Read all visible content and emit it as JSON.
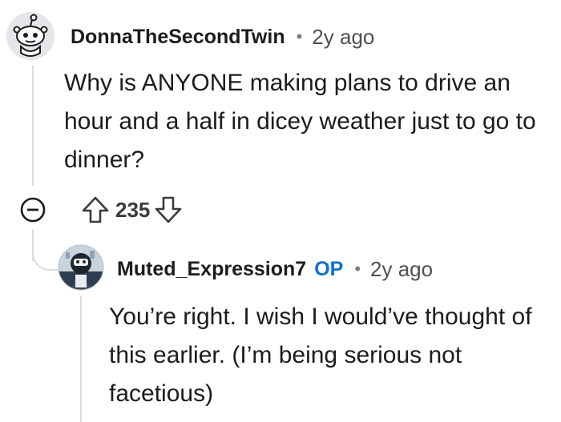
{
  "comment1": {
    "avatar_icon": "reddit-snoo-avatar-icon",
    "username": "DonnaTheSecondTwin",
    "separator": "•",
    "age": "2y ago",
    "body": "Why is ANYONE making plans to drive an hour and a half in dicey weather just to go to dinner?",
    "collapse_icon": "collapse-minus-icon",
    "upvote_icon": "upvote-arrow-icon",
    "score": "235",
    "downvote_icon": "downvote-arrow-icon"
  },
  "comment2": {
    "avatar_icon": "user-avatar-icon",
    "username": "Muted_Expression7",
    "op_badge": "OP",
    "separator": "•",
    "age": "2y ago",
    "body": "You’re right. I wish I would’ve thought of this earlier. (I’m being serious not facetious)"
  },
  "colors": {
    "op_badge": "#0a6fd1",
    "thread_line": "#dcdcdc",
    "text": "#1c1c1c",
    "meta": "#4f4f4f"
  }
}
